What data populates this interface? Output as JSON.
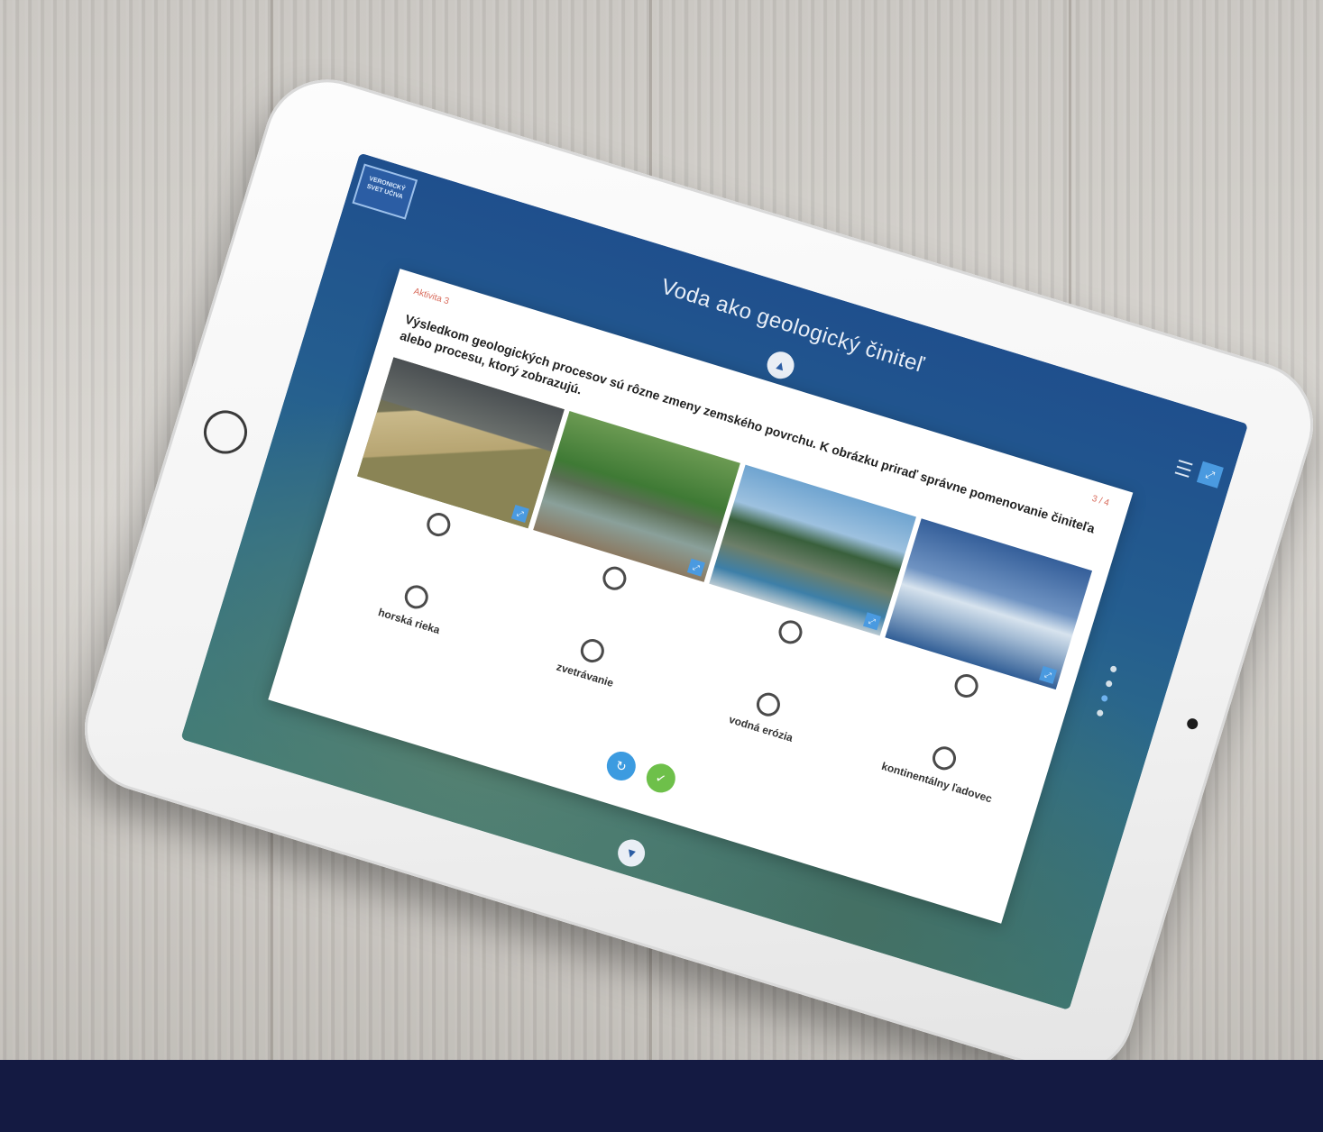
{
  "app": {
    "logo_text": "VERONICKÝ SVET UČIVA",
    "title": "Voda ako geologický činiteľ"
  },
  "exercise": {
    "activity_label": "Aktivita 3",
    "progress_label": "3 / 4",
    "instruction": "Výsledkom geologických procesov sú rôzne zmeny zemského povrchu. K obrázku priraď správne pomenovanie činiteľa alebo procesu, ktorý zobrazujú.",
    "images": [
      {
        "name": "cliff-photo",
        "zoom_icon": "expand-icon"
      },
      {
        "name": "forest-river-photo",
        "zoom_icon": "expand-icon"
      },
      {
        "name": "lake-stones-photo",
        "zoom_icon": "expand-icon"
      },
      {
        "name": "glacier-photo",
        "zoom_icon": "expand-icon"
      }
    ],
    "options": [
      "horská rieka",
      "zvetrávanie",
      "vodná erózia",
      "kontinentálny ľadovec"
    ],
    "check_button_icon": "refresh-icon",
    "ok_button_icon": "check-icon"
  },
  "navigation": {
    "up_icon": "chevron-up-icon",
    "down_icon": "chevron-down-icon",
    "menu_icon": "hamburger-menu-icon",
    "fullscreen_icon": "fullscreen-icon",
    "page_count": 4,
    "active_page": 3
  },
  "colors": {
    "footer_band": "#141a42",
    "accent_blue": "#3c9be0",
    "accent_green": "#6ec04a",
    "activity_label": "#d86a5a"
  }
}
